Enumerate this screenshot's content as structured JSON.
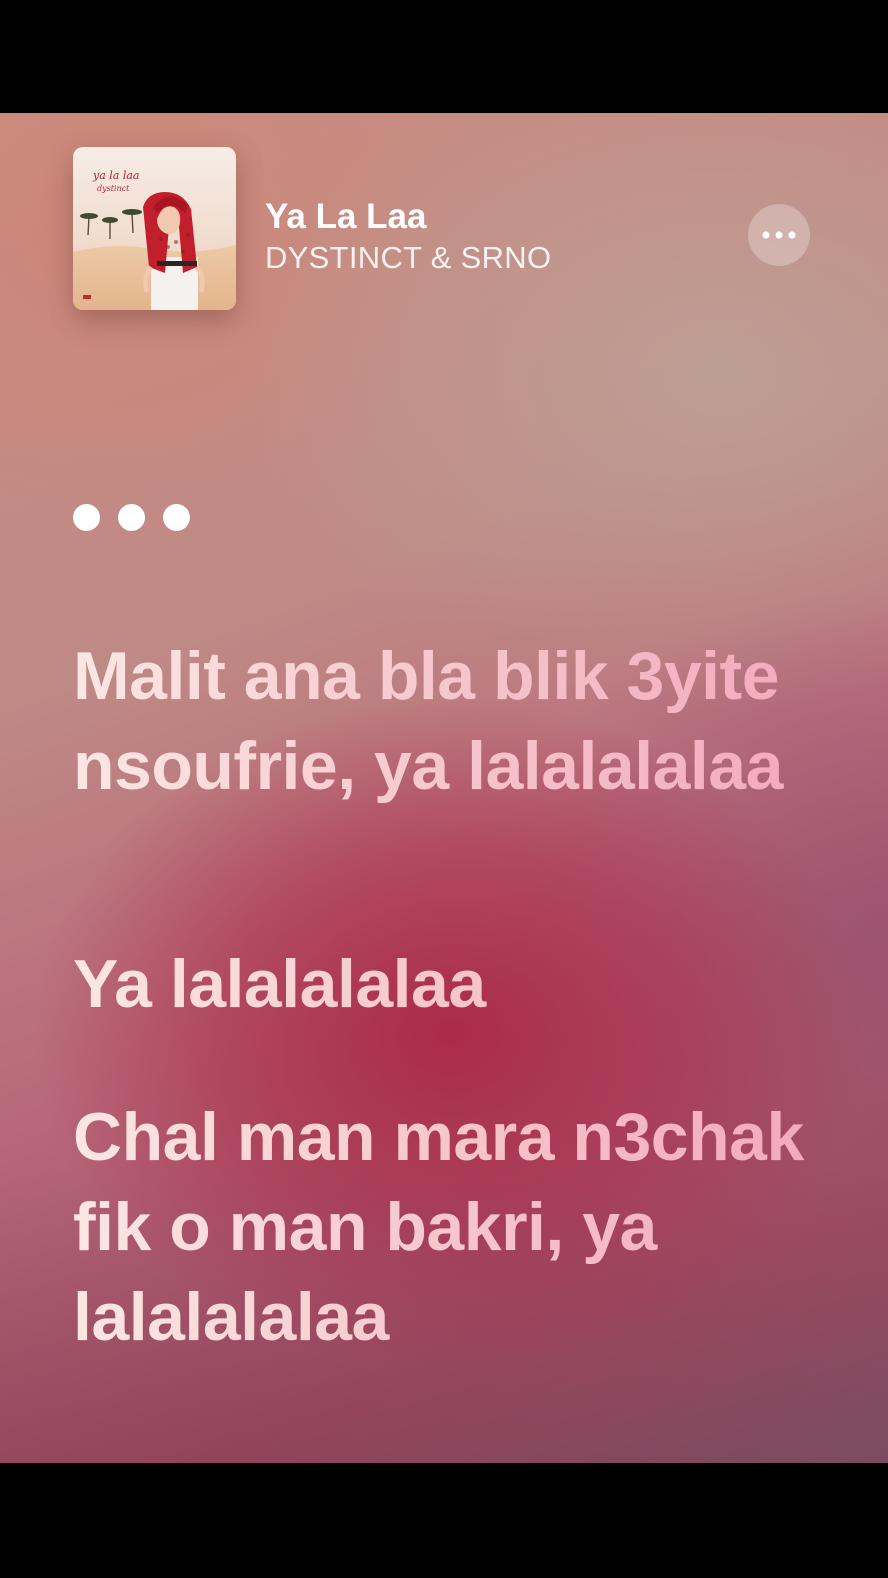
{
  "now_playing": {
    "title": "Ya La Laa",
    "artist": "DYSTINCT & SRNO",
    "artwork": {
      "text_title": "ya la laa",
      "text_artist": "dystinct"
    }
  },
  "more_button": {
    "icon": "ellipsis-icon"
  },
  "interlude_indicator": {
    "icon": "three-dots"
  },
  "lyrics": [
    "Malit ana bla blik 3yite nsoufrie, ya lalalalalaa",
    "Ya lalalalalaa",
    "Chal man mara n3chak fik o man bakri, ya lalalalalaa"
  ],
  "colors": {
    "background_top": "#c98c80",
    "background_center": "#aa2846",
    "lyric_text_start": "#fbe7e3",
    "lyric_text_end": "#f3a9bd"
  }
}
